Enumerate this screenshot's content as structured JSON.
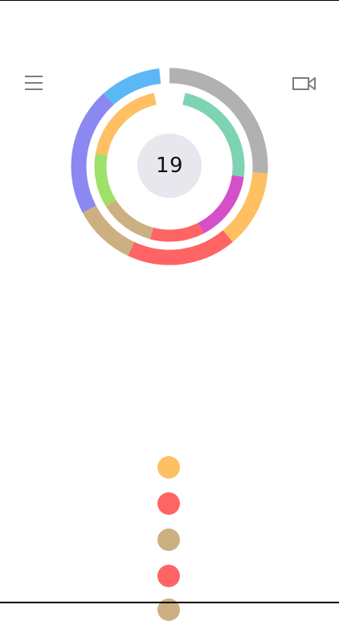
{
  "score": "19",
  "header": {
    "menu_icon": "hamburger-menu-icon",
    "camera_icon": "video-camera-icon"
  },
  "outer_ring": [
    {
      "color": "#b1b1b1",
      "start": 0,
      "end": 94
    },
    {
      "color": "#fec062",
      "start": 94,
      "end": 140
    },
    {
      "color": "#ff6464",
      "start": 140,
      "end": 205
    },
    {
      "color": "#cdb081",
      "start": 205,
      "end": 242
    },
    {
      "color": "#8b88f2",
      "start": 242,
      "end": 318
    },
    {
      "color": "#5bb8f4",
      "start": 318,
      "end": 354
    }
  ],
  "inner_ring": [
    {
      "color": "#7ed3b2",
      "start": 12,
      "end": 98
    },
    {
      "color": "#d44fc8",
      "start": 98,
      "end": 153
    },
    {
      "color": "#ff6464",
      "start": 153,
      "end": 195
    },
    {
      "color": "#cdb081",
      "start": 195,
      "end": 238
    },
    {
      "color": "#9ee06a",
      "start": 238,
      "end": 280
    },
    {
      "color": "#fec062",
      "start": 280,
      "end": 348
    }
  ],
  "queue": [
    {
      "color": "#fec062"
    },
    {
      "color": "#ff6464"
    },
    {
      "color": "#cdb081"
    },
    {
      "color": "#ff6464"
    },
    {
      "color": "#cdb081"
    }
  ]
}
